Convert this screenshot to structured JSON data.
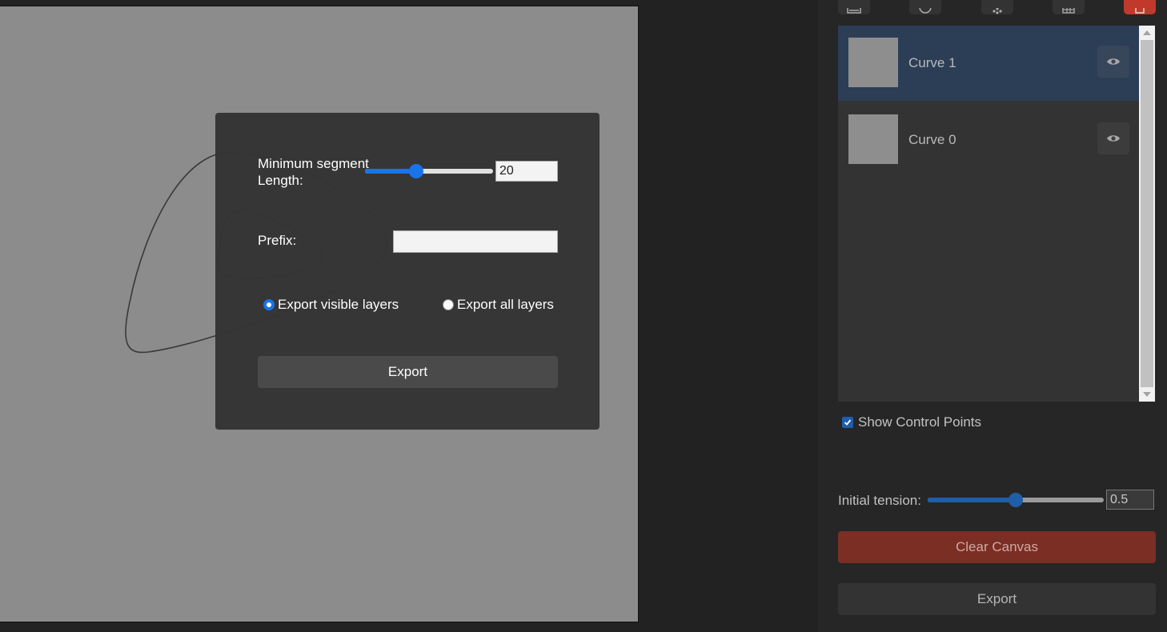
{
  "layers": [
    {
      "name": "Curve 1",
      "active": true
    },
    {
      "name": "Curve 0",
      "active": false
    }
  ],
  "sidebar": {
    "show_control_points": "Show Control Points",
    "initial_tension_label": "Initial tension:",
    "initial_tension_value": "0.5",
    "initial_tension_fraction": 0.5,
    "clear_canvas": "Clear Canvas",
    "export": "Export"
  },
  "toolbar": {
    "icons": [
      "image-icon",
      "circle-icon",
      "points-icon",
      "grid-icon",
      "trash-icon"
    ]
  },
  "export_dialog": {
    "min_segment_label": "Minimum segment Length:",
    "min_segment_value": "20",
    "min_segment_fraction": 0.4,
    "prefix_label": "Prefix:",
    "prefix_value": "",
    "radio_visible": "Export visible layers",
    "radio_all": "Export all layers",
    "selected": "visible",
    "export_button": "Export"
  },
  "colors": {
    "accent_blue": "#1a73e8",
    "danger": "#c0392b",
    "active_layer": "#2c3e56"
  }
}
